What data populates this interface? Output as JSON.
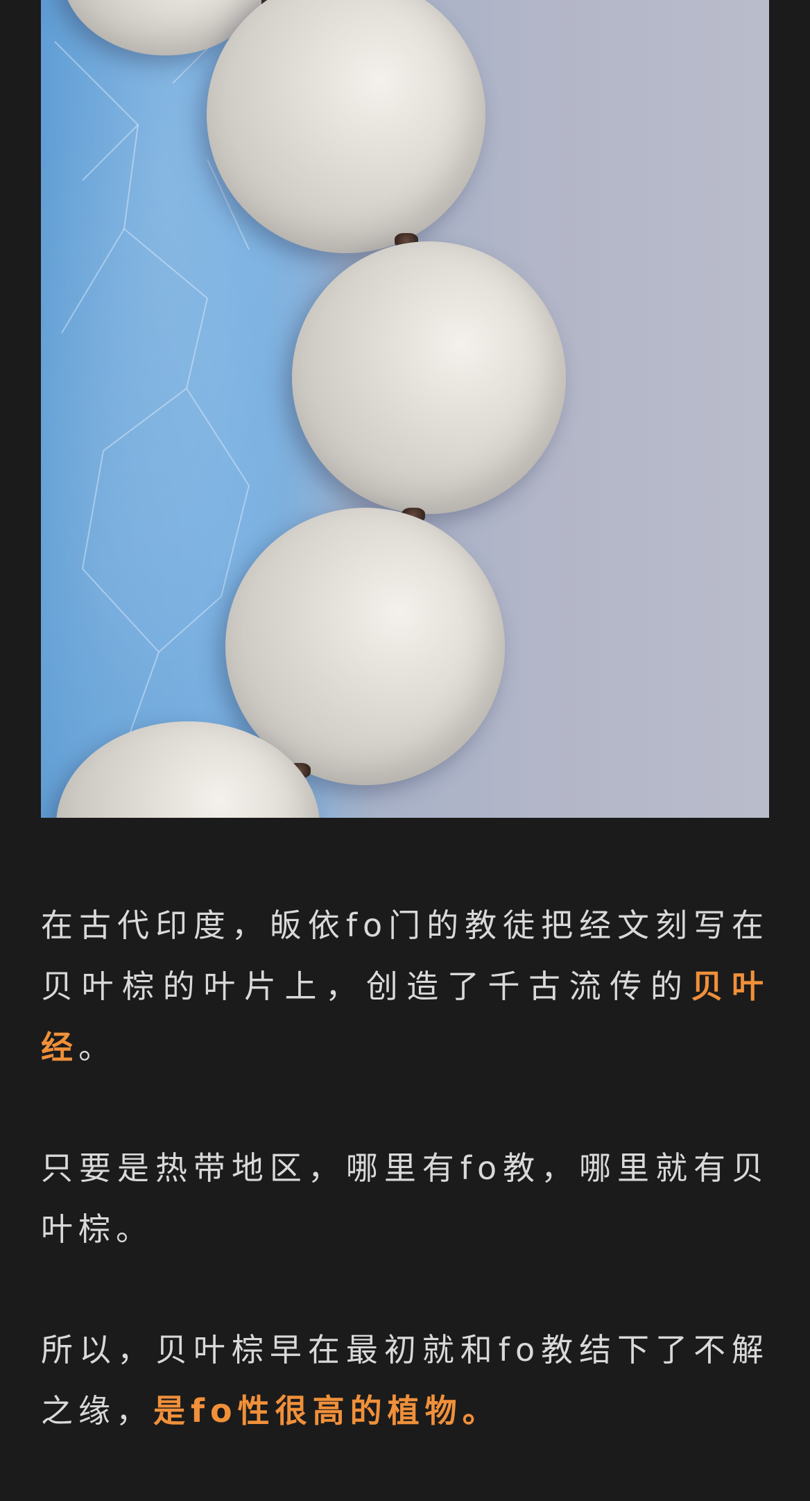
{
  "article": {
    "photo_alt": "白色贝叶棕佛珠手串",
    "paragraphs": [
      {
        "pre": "在古代印度，皈依fo门的教徒把经文刻写在贝叶棕的叶片上，创造了千古流传的",
        "highlight": "贝叶经",
        "post": "。"
      },
      {
        "pre": "只要是热带地区，哪里有fo教，哪里就有贝叶棕。",
        "highlight": "",
        "post": ""
      },
      {
        "pre": "所以，贝叶棕早在最初就和fo教结下了不解之缘，",
        "highlight": "是fo性很高的植物。",
        "post": ""
      }
    ]
  },
  "colors": {
    "background": "#1b1b1b",
    "text": "#d9d9d9",
    "highlight": "#f0903a"
  }
}
